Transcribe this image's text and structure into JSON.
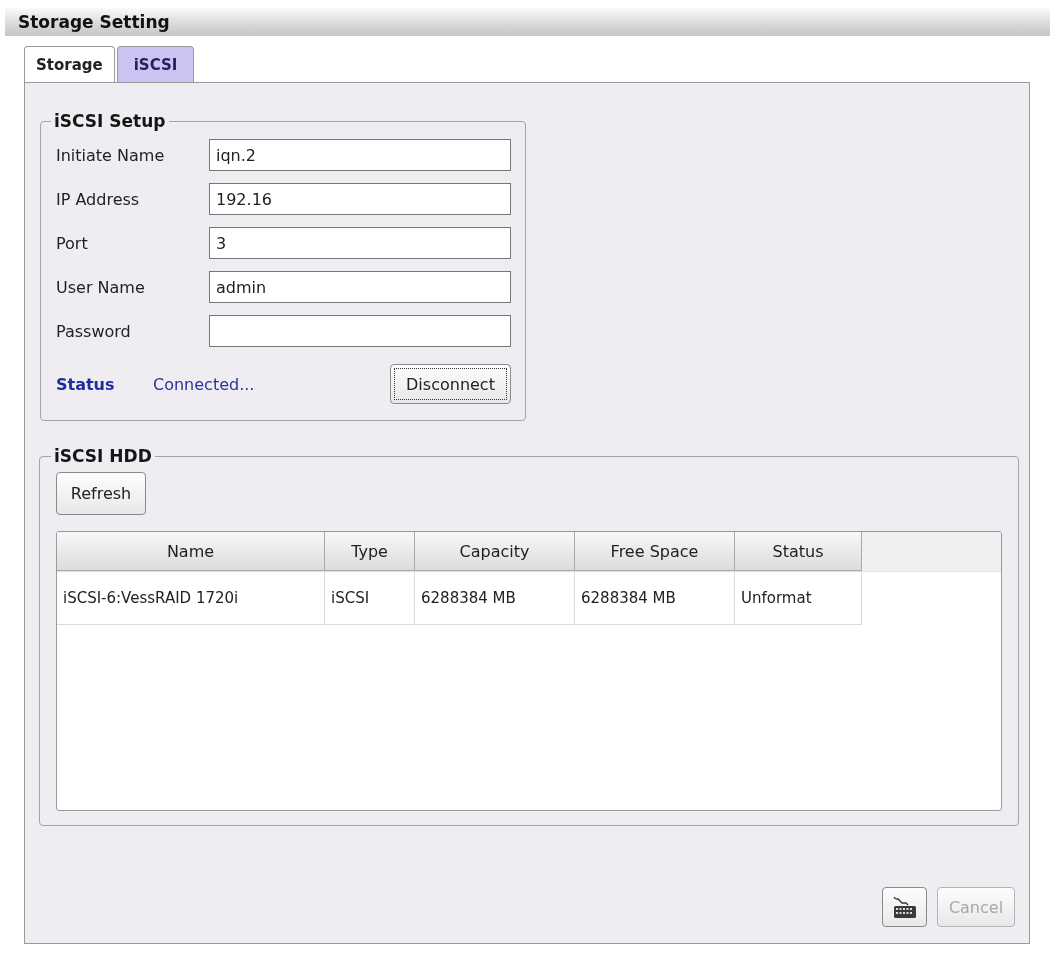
{
  "window": {
    "title": "Storage Setting"
  },
  "tabs": [
    {
      "label": "Storage",
      "selected": false
    },
    {
      "label": "iSCSI",
      "selected": true
    }
  ],
  "iscsi_setup": {
    "title": "iSCSI Setup",
    "fields": [
      {
        "label": "Initiate Name",
        "value": "iqn.2"
      },
      {
        "label": "IP Address",
        "value": "192.16"
      },
      {
        "label": "Port",
        "value": "3"
      },
      {
        "label": "User Name",
        "value": "admin"
      },
      {
        "label": "Password"
      }
    ],
    "status": {
      "label": "Status",
      "value": "Connected..."
    },
    "disconnect_button": {
      "label": "Disconnect",
      "focused": true
    }
  },
  "iscsi_hdd": {
    "title": "iSCSI HDD",
    "refresh_button": {
      "label": "Refresh"
    },
    "table": {
      "columns": [
        "Name",
        "Type",
        "Capacity",
        "Free Space",
        "Status"
      ],
      "rows": [
        [
          "iSCSI-6:VessRAID 1720i",
          "iSCSI",
          "6288384 MB",
          "6288384 MB",
          "Unformat"
        ]
      ]
    }
  },
  "footer": {
    "buttons": [
      {
        "kind": "icon",
        "disabled": false
      },
      {
        "kind": "text",
        "label": "Cancel",
        "disabled": true
      }
    ]
  }
}
